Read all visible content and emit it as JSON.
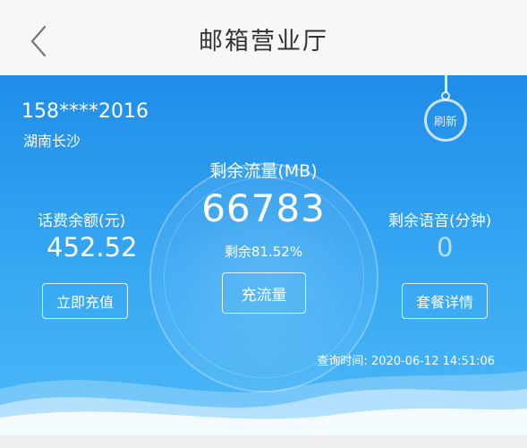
{
  "header": {
    "title": "邮箱营业厅",
    "back_icon": "chevron-left-icon"
  },
  "account": {
    "phone": "158****2016",
    "location": "湖南长沙"
  },
  "refresh": {
    "label": "刷新"
  },
  "traffic": {
    "label": "剩余流量(MB)",
    "value": "66783",
    "remaining_percent": "剩余81.52%"
  },
  "balance": {
    "label": "话费余额(元)",
    "value": "452.52",
    "button": "立即充值"
  },
  "voice": {
    "label": "剩余语音(分钟)",
    "value": "0",
    "button": "套餐详情"
  },
  "center_button": "充流量",
  "query_time": "查询时间: 2020-06-12 14:51:06",
  "colors": {
    "panel_top": "#1f8de8",
    "panel_bottom": "#4db8f8",
    "header_bg": "#f7f7f7"
  }
}
